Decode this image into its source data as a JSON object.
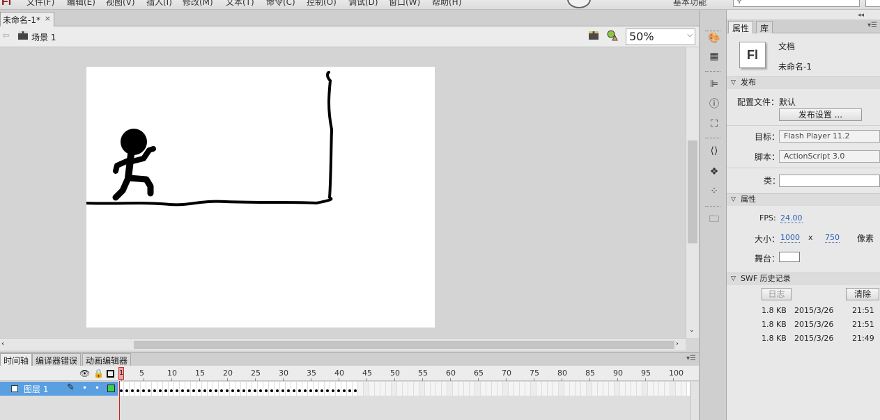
{
  "app": {
    "logo": "Fl"
  },
  "menu": [
    "文件(F)",
    "编辑(E)",
    "视图(V)",
    "插入(I)",
    "修改(M)",
    "文本(T)",
    "命令(C)",
    "控制(O)",
    "调试(D)",
    "窗口(W)",
    "帮助(H)"
  ],
  "workspace_label": "基本功能",
  "doc_tab": {
    "title": "未命名-1*",
    "close": "×"
  },
  "scene": {
    "label": "场景 1",
    "zoom": "50%"
  },
  "timeline": {
    "tabs": [
      "时间轴",
      "编译器错误",
      "动画编辑器"
    ],
    "ruler_numbers": [
      "1",
      "5",
      "10",
      "15",
      "20",
      "25",
      "30",
      "35",
      "40",
      "45",
      "50",
      "55",
      "60",
      "65",
      "70",
      "75",
      "80",
      "85",
      "90",
      "95",
      "100"
    ],
    "layer": {
      "name": "图层 1",
      "filled_frames": 43
    },
    "current_frame": "1"
  },
  "properties": {
    "tabs": [
      "属性",
      "库"
    ],
    "doc_icon": "Fl",
    "doc_type": "文档",
    "doc_name": "未命名-1",
    "publish_section": "发布",
    "profile_label": "配置文件：",
    "profile_value": "默认",
    "publish_settings_btn": "发布设置 ...",
    "target_label": "目标：",
    "target_value": "Flash Player 11.2",
    "script_label": "脚本：",
    "script_value": "ActionScript 3.0",
    "class_label": "类：",
    "class_value": "",
    "props_section": "属性",
    "fps_label": "FPS:",
    "fps_value": "24.00",
    "size_label": "大小：",
    "width": "1000",
    "x": "x",
    "height": "750",
    "unit": "像素",
    "stage_label": "舞台：",
    "stage_color": "#ffffff",
    "swf_section": "SWF 历史记录",
    "log_btn": "日志",
    "clear_btn": "清除",
    "history": [
      {
        "size": "1.8 KB",
        "date": "2015/3/26",
        "time": "21:51"
      },
      {
        "size": "1.8 KB",
        "date": "2015/3/26",
        "time": "21:51"
      },
      {
        "size": "1.8 KB",
        "date": "2015/3/26",
        "time": "21:49"
      }
    ]
  },
  "colors": {
    "layer_highlight": "#5a9fe0",
    "keyframe_green": "#3cd050",
    "playhead_red": "#d02020",
    "link_blue": "#2a62b8"
  }
}
